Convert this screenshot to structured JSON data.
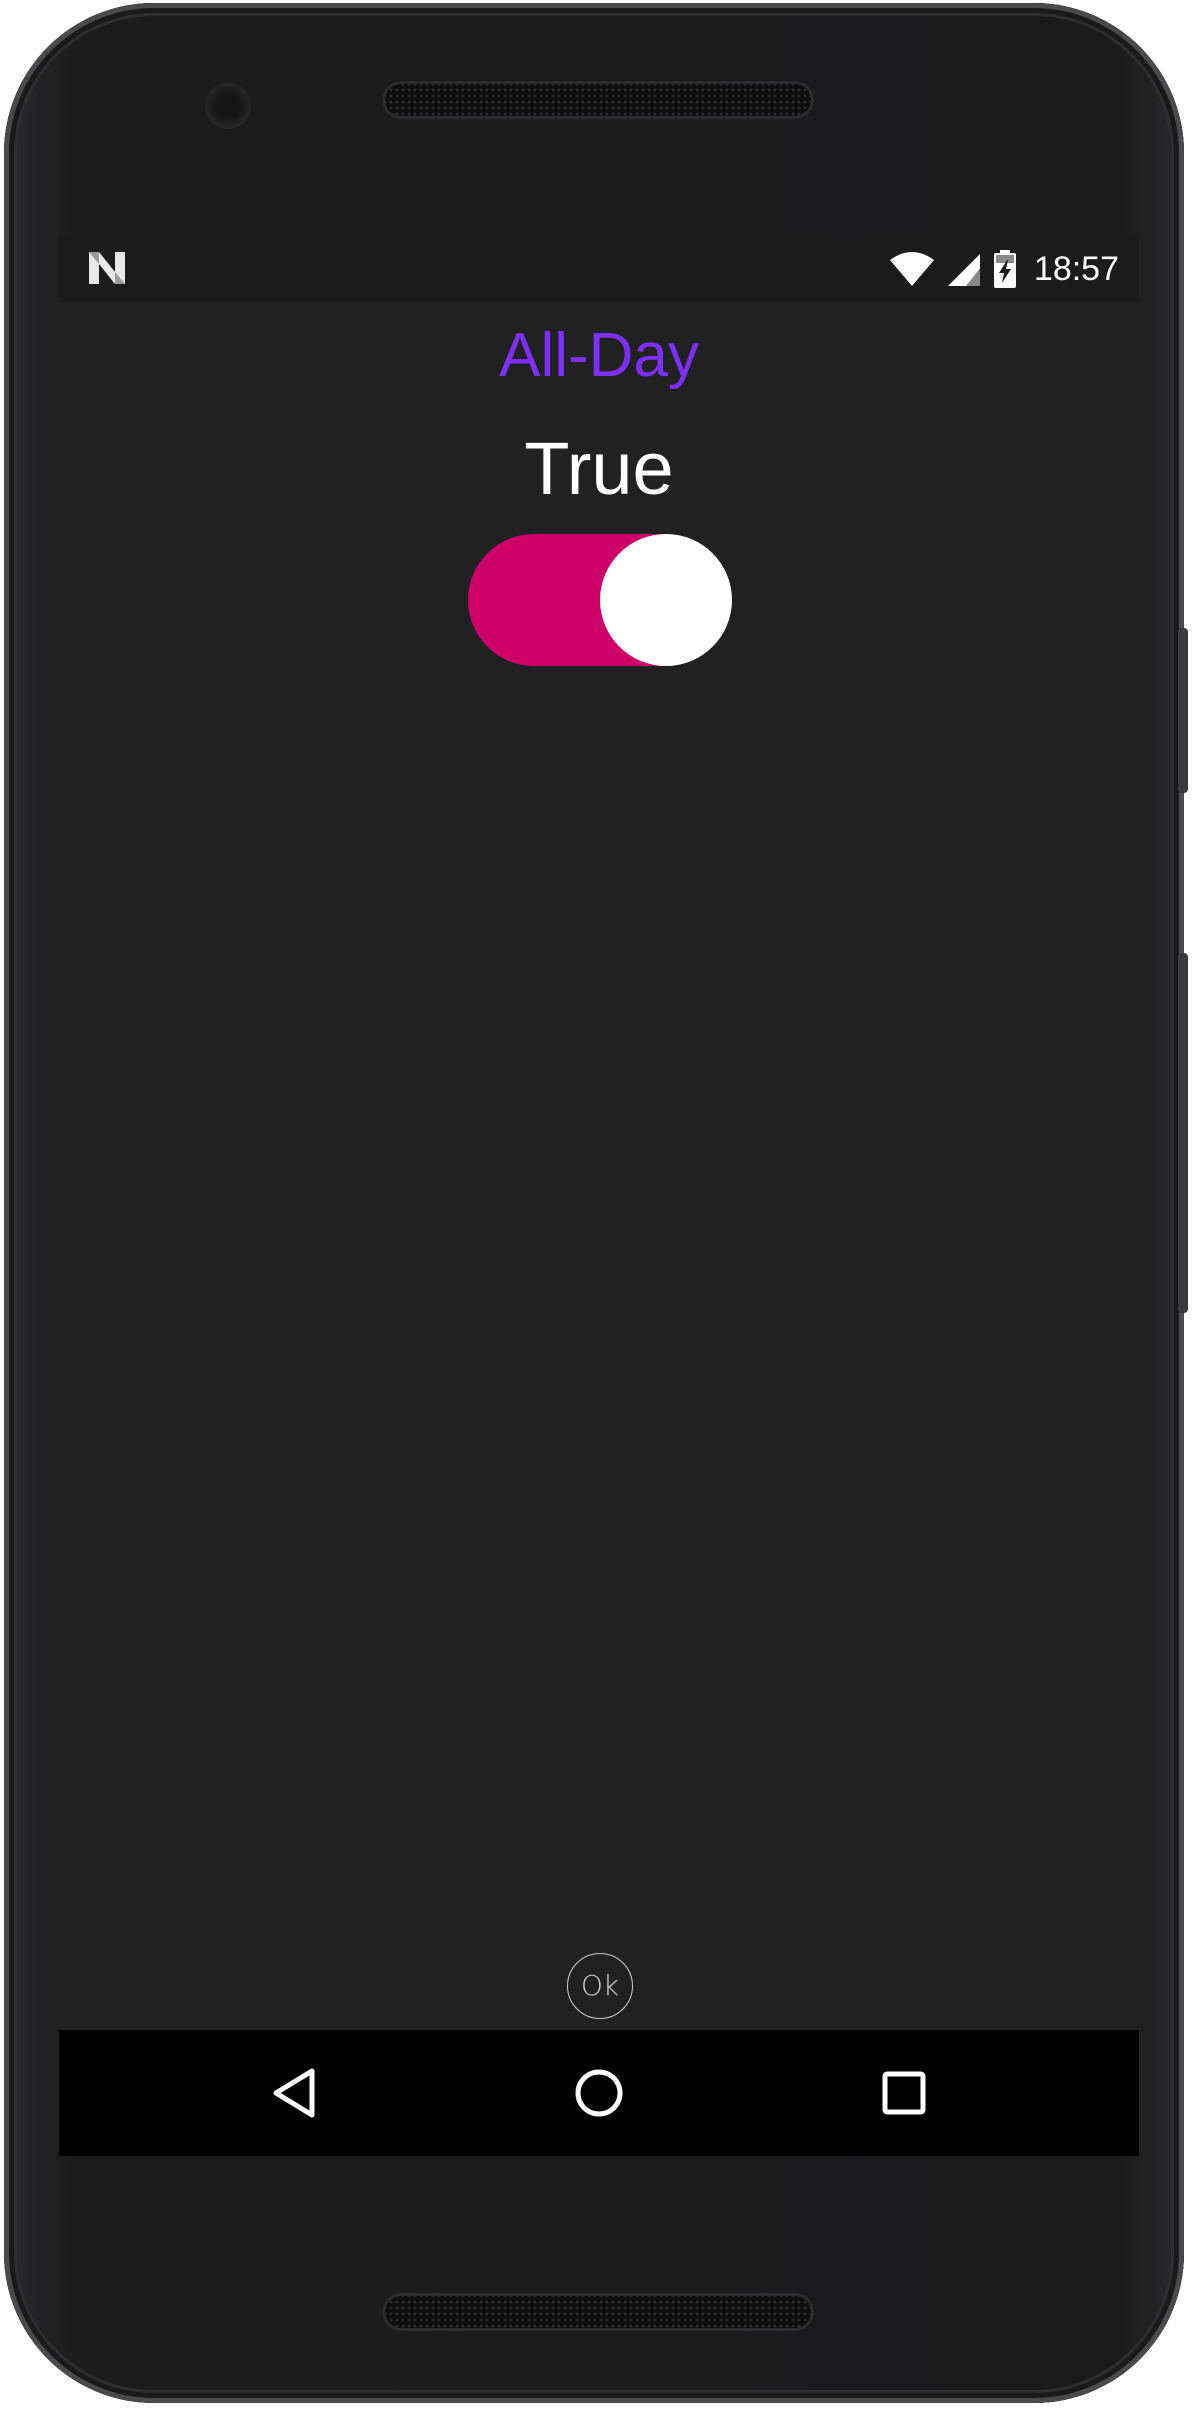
{
  "status_bar": {
    "time": "18:57",
    "notification_icon": "n-logo-icon",
    "icons": [
      "wifi-icon",
      "cell-signal-icon",
      "battery-charging-icon"
    ]
  },
  "screen": {
    "title": "All-Day",
    "value_label": "True",
    "toggle": {
      "state": "on",
      "track_color": "#cc0066",
      "thumb_color": "#ffffff"
    },
    "ok_button_label": "Ok"
  },
  "nav_bar": {
    "items": [
      {
        "name": "back-icon"
      },
      {
        "name": "home-icon"
      },
      {
        "name": "recents-icon"
      }
    ]
  },
  "colors": {
    "title": "#7b2ff7",
    "background": "#212121",
    "nav_bar": "#000000"
  }
}
